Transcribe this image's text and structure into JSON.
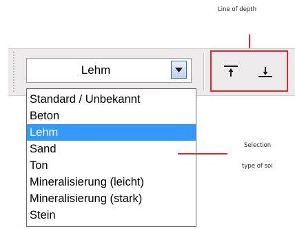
{
  "annotations": {
    "line_of_depth": "Line of depth",
    "selection": "Selection",
    "type_of_soil": "type of soi"
  },
  "soil_combo": {
    "selected_value": "Lehm",
    "dropdown_icon": "chevron-down-icon"
  },
  "depth_buttons": [
    {
      "icon": "align-top-icon"
    },
    {
      "icon": "align-bottom-icon"
    }
  ],
  "soil_options": [
    {
      "label": "Standard / Unbekannt",
      "selected": false
    },
    {
      "label": "Beton",
      "selected": false
    },
    {
      "label": "Lehm",
      "selected": true
    },
    {
      "label": "Sand",
      "selected": false
    },
    {
      "label": "Ton",
      "selected": false
    },
    {
      "label": "Mineralisierung (leicht)",
      "selected": false
    },
    {
      "label": "Mineralisierung (stark)",
      "selected": false
    },
    {
      "label": "Stein",
      "selected": false
    }
  ],
  "colors": {
    "annotation_red": "#e8262b",
    "selection_blue": "#3399ff",
    "toolbar_bg": "#eceaea"
  }
}
